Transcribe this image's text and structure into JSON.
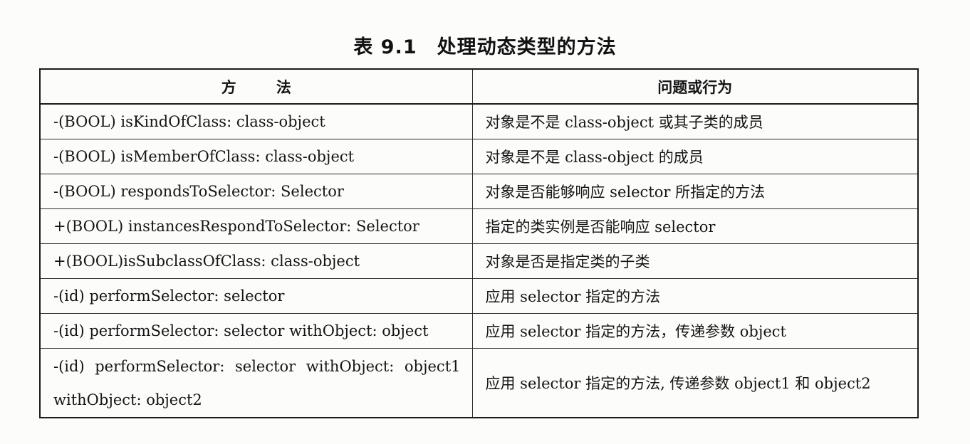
{
  "caption": {
    "number": "表 9.1",
    "title": "处理动态类型的方法"
  },
  "table": {
    "headers": {
      "method_a": "方",
      "method_b": "法",
      "behavior": "问题或行为"
    },
    "rows": [
      {
        "method": "-(BOOL) isKindOfClass: class-object",
        "behavior": "对象是不是 class-object 或其子类的成员"
      },
      {
        "method": "-(BOOL) isMemberOfClass: class-object",
        "behavior": "对象是不是 class-object 的成员"
      },
      {
        "method": "-(BOOL) respondsToSelector: Selector",
        "behavior": "对象是否能够响应 selector 所指定的方法"
      },
      {
        "method": "+(BOOL) instancesRespondToSelector: Selector",
        "behavior": "指定的类实例是否能响应 selector"
      },
      {
        "method": "+(BOOL)isSubclassOfClass: class-object",
        "behavior": "对象是否是指定类的子类"
      },
      {
        "method": "-(id) performSelector: selector",
        "behavior": "应用 selector 指定的方法"
      },
      {
        "method": "-(id) performSelector: selector withObject: object",
        "behavior": "应用 selector 指定的方法，传递参数 object"
      },
      {
        "method": "-(id) performSelector: selector withObject: object1 withObject: object2",
        "behavior": "应用 selector 指定的方法, 传递参数 object1 和 object2"
      }
    ]
  }
}
